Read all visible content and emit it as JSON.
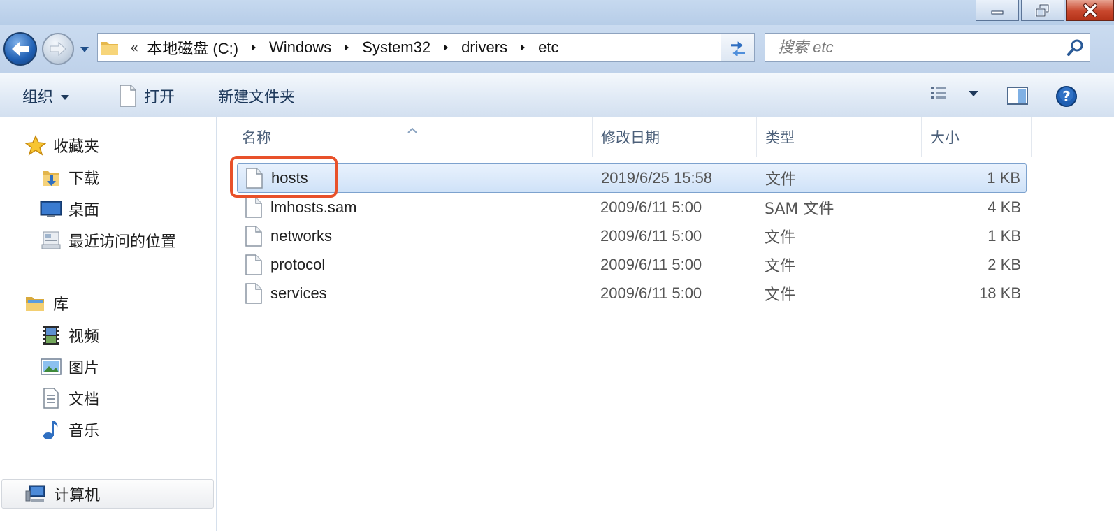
{
  "address": {
    "overflow": "«",
    "crumbs": [
      "本地磁盘 (C:)",
      "Windows",
      "System32",
      "drivers",
      "etc"
    ]
  },
  "search": {
    "placeholder": "搜索 etc"
  },
  "toolbar": {
    "organize": "组织",
    "open": "打开",
    "new_folder": "新建文件夹"
  },
  "navpane": {
    "favorites": {
      "label": "收藏夹",
      "items": [
        {
          "label": "下载",
          "icon": "downloads-folder-icon"
        },
        {
          "label": "桌面",
          "icon": "desktop-icon"
        },
        {
          "label": "最近访问的位置",
          "icon": "recent-places-icon"
        }
      ]
    },
    "libraries": {
      "label": "库",
      "items": [
        {
          "label": "视频",
          "icon": "video-library-icon"
        },
        {
          "label": "图片",
          "icon": "picture-library-icon"
        },
        {
          "label": "文档",
          "icon": "document-library-icon"
        },
        {
          "label": "音乐",
          "icon": "music-library-icon"
        }
      ]
    },
    "computer": {
      "label": "计算机"
    }
  },
  "columns": {
    "name": "名称",
    "modified": "修改日期",
    "type": "类型",
    "size": "大小"
  },
  "files": [
    {
      "name": "hosts",
      "modified": "2019/6/25 15:58",
      "type": "文件",
      "size": "1 KB",
      "selected": true
    },
    {
      "name": "lmhosts.sam",
      "modified": "2009/6/11 5:00",
      "type": "SAM 文件",
      "size": "4 KB"
    },
    {
      "name": "networks",
      "modified": "2009/6/11 5:00",
      "type": "文件",
      "size": "1 KB"
    },
    {
      "name": "protocol",
      "modified": "2009/6/11 5:00",
      "type": "文件",
      "size": "2 KB"
    },
    {
      "name": "services",
      "modified": "2009/6/11 5:00",
      "type": "文件",
      "size": "18 KB"
    }
  ],
  "colors": {
    "highlight_annotation": "#e8512a",
    "selection": "#cfe2f8",
    "chrome": "#bfd2ea"
  }
}
